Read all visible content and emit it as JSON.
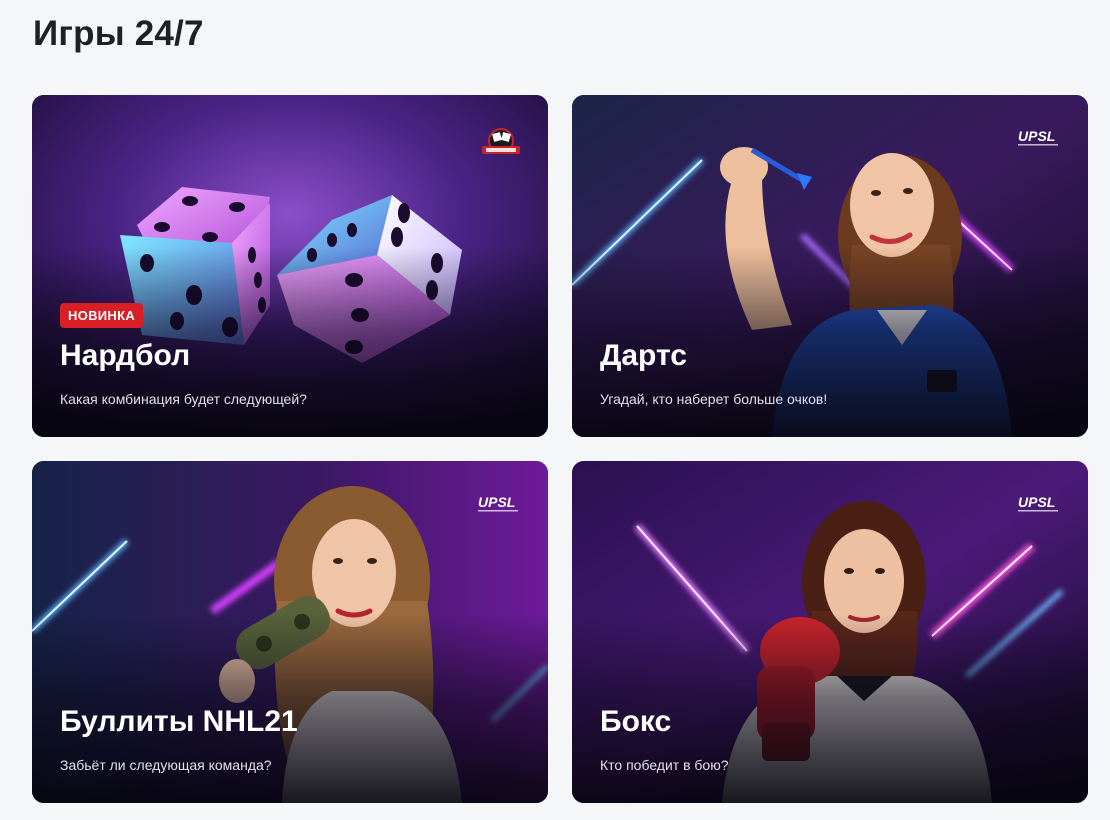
{
  "page": {
    "title": "Игры 24/7"
  },
  "cards": [
    {
      "title": "Нардбол",
      "subtitle": "Какая комбинация будет следующей?",
      "badge": "НОВИНКА",
      "logo": "NARDBALL",
      "image": "dice-illustration"
    },
    {
      "title": "Дартс",
      "subtitle": "Угадай, кто наберет больше очков!",
      "logo": "UPSL",
      "image": "woman-throwing-dart"
    },
    {
      "title": "Буллиты NHL21",
      "subtitle": "Забьёт ли следующая команда?",
      "logo": "UPSL",
      "image": "woman-holding-gamepad"
    },
    {
      "title": "Бокс",
      "subtitle": "Кто победит в бою?",
      "logo": "UPSL",
      "image": "woman-boxing-glove"
    }
  ],
  "colors": {
    "badge": "#d81f26",
    "neon_blue": "#4fa8ff",
    "neon_pink": "#d63cff",
    "card_bg": "#1a0f2e"
  }
}
